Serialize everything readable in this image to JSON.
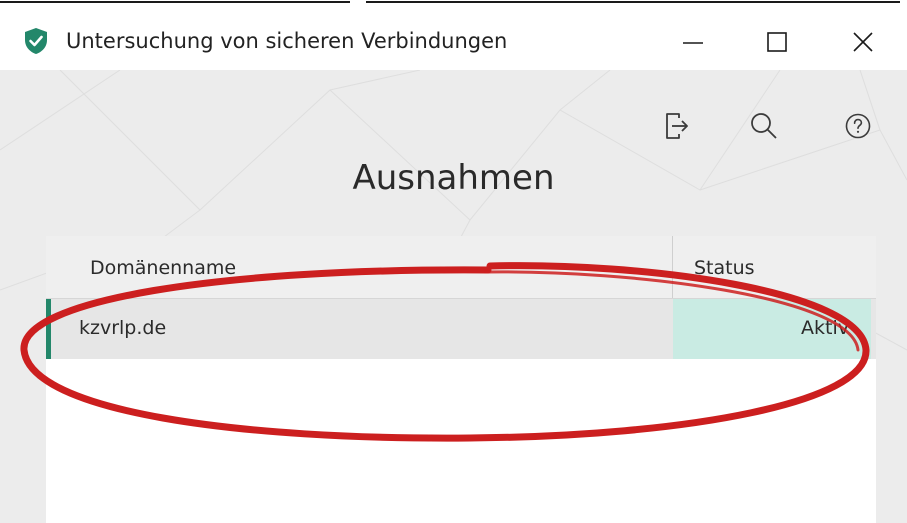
{
  "window": {
    "title": "Untersuchung von sicheren Verbindungen",
    "app_icon": "kaspersky-shield-icon",
    "controls": [
      {
        "name": "minimize",
        "icon": "minimize-icon"
      },
      {
        "name": "maximize",
        "icon": "maximize-icon"
      },
      {
        "name": "close",
        "icon": "close-icon"
      }
    ]
  },
  "toolbar": {
    "icons": [
      "export-icon",
      "search-icon",
      "help-icon"
    ]
  },
  "page": {
    "title": "Ausnahmen"
  },
  "table": {
    "columns": [
      "Domänenname",
      "Status"
    ],
    "rows": [
      {
        "domain": "kzvrlp.de",
        "status": "Aktiv",
        "selected": true
      }
    ]
  },
  "colors": {
    "brand_green": "#23876a",
    "status_active_bg": "#c9ebe3",
    "annotation_red": "#cc1f1f",
    "content_bg": "#ececec"
  }
}
